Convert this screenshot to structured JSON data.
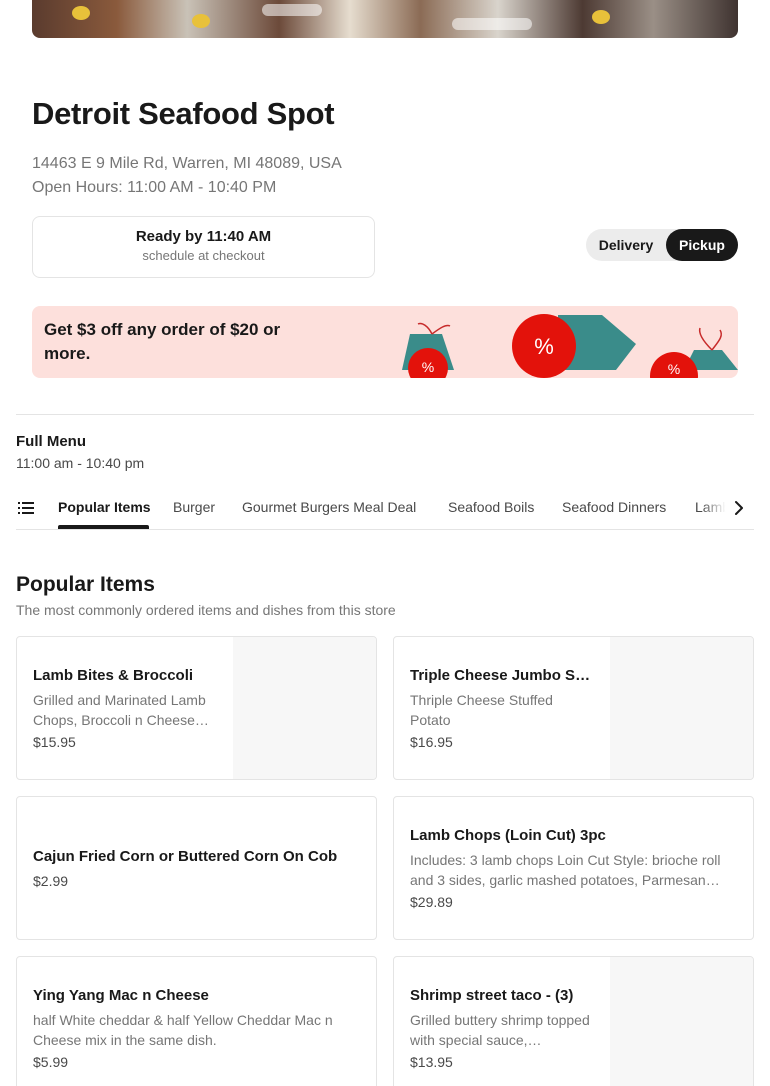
{
  "store": {
    "name": "Detroit Seafood Spot",
    "address": "14463 E 9 Mile Rd, Warren, MI 48089, USA",
    "open_hours": "Open Hours: 11:00 AM - 10:40 PM"
  },
  "ready": {
    "time": "Ready by 11:40 AM",
    "note": "schedule at checkout"
  },
  "mode_toggle": {
    "delivery": "Delivery",
    "pickup": "Pickup",
    "selected": "Pickup"
  },
  "promo": {
    "text": "Get $3 off any order of $20 or more.",
    "badge_symbol": "%",
    "accent_red": "#e3120b",
    "accent_teal": "#3a8c8a",
    "background": "#fde0dc"
  },
  "menu": {
    "title": "Full Menu",
    "hours": "11:00 am - 10:40 pm"
  },
  "tabs": {
    "icon": "list-icon",
    "items": [
      "Popular Items",
      "Burger",
      "Gourmet Burgers Meal Deal",
      "Seafood Boils",
      "Seafood Dinners",
      "Lamb"
    ],
    "active": "Popular Items",
    "scroll_icon": "chevron-right-icon"
  },
  "section": {
    "title": "Popular Items",
    "subtitle": "The most commonly ordered items and dishes from this store"
  },
  "items": [
    {
      "name": "Lamb Bites & Broccoli",
      "desc": "Grilled and Marinated Lamb Chops, Broccoli n Cheese…",
      "price": "$15.95"
    },
    {
      "name": "Triple Cheese Jumbo Sh…",
      "desc": "Thriple Cheese Stuffed Potato",
      "price": "$16.95"
    },
    {
      "name": "Cajun Fried Corn or Buttered Corn On Cob",
      "desc": "",
      "price": "$2.99"
    },
    {
      "name": "Lamb Chops (Loin Cut) 3pc",
      "desc": "Includes: 3 lamb chops Loin Cut Style: brioche roll and 3 sides, garlic mashed potatoes, Parmesan…",
      "price": "$29.89"
    },
    {
      "name": "Ying Yang Mac n Cheese",
      "desc": "half White cheddar & half Yellow Cheddar Mac n Cheese mix in the same dish.",
      "price": "$5.99"
    },
    {
      "name": "Shrimp street taco - (3)",
      "desc": "Grilled buttery shrimp topped with special sauce,…",
      "price": "$13.95"
    }
  ]
}
